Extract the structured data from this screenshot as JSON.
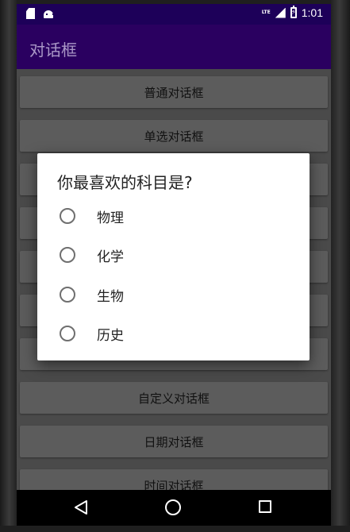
{
  "status_bar": {
    "time": "1:01",
    "network_label": "LTE",
    "icons": [
      "sd-card-icon",
      "android-icon",
      "signal-icon",
      "battery-charging-icon"
    ]
  },
  "app_bar": {
    "title": "对话框"
  },
  "buttons": [
    {
      "label": "普通对话框"
    },
    {
      "label": "单选对话框"
    },
    {
      "label": ""
    },
    {
      "label": ""
    },
    {
      "label": ""
    },
    {
      "label": ""
    },
    {
      "label": ""
    },
    {
      "label": "自定义对话框"
    },
    {
      "label": "日期对话框"
    },
    {
      "label": "时间对话框"
    }
  ],
  "dialog": {
    "title": "你最喜欢的科目是?",
    "options": [
      {
        "label": "物理",
        "checked": false
      },
      {
        "label": "化学",
        "checked": false
      },
      {
        "label": "生物",
        "checked": false
      },
      {
        "label": "历史",
        "checked": false
      }
    ]
  },
  "nav_bar": {
    "icons": [
      "back-icon",
      "home-icon",
      "recent-apps-icon"
    ]
  },
  "colors": {
    "status_bar": "#1d0059",
    "app_bar": "#2a0060",
    "app_title": "#aa98c7",
    "button_bg": "#5c5c5c",
    "screen_bg": "#4a4a4a"
  }
}
